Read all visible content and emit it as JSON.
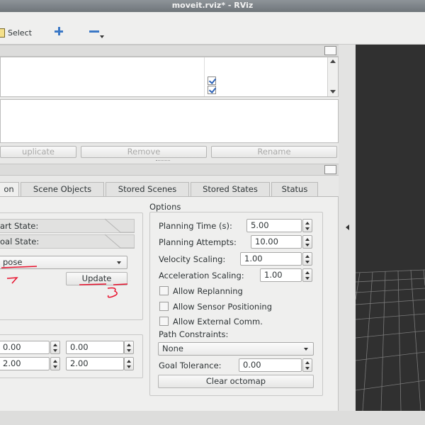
{
  "window": {
    "title": "moveit.rviz* - RViz"
  },
  "toolbar": {
    "select_label": "Select",
    "add_icon": "plus-icon",
    "remove_icon": "minus-icon"
  },
  "scene_list": {
    "checkboxes": [
      true,
      true
    ]
  },
  "list_buttons": {
    "duplicate": "uplicate",
    "remove": "Remove",
    "rename": "Rename"
  },
  "tabs": [
    {
      "label": "on",
      "active": true
    },
    {
      "label": "Scene Objects"
    },
    {
      "label": "Stored Scenes"
    },
    {
      "label": "Stored States"
    },
    {
      "label": "Status"
    }
  ],
  "planning": {
    "start_state_label": "art State:",
    "goal_state_label": "oal State:",
    "goal_combo_value": "pose",
    "update_button": "Update",
    "workspace_values": [
      [
        "0.00",
        "0.00"
      ],
      [
        "2.00",
        "2.00"
      ]
    ]
  },
  "options": {
    "title": "Options",
    "planning_time_label": "Planning Time (s):",
    "planning_time_value": "5.00",
    "planning_attempts_label": "Planning Attempts:",
    "planning_attempts_value": "10.00",
    "velocity_scaling_label": "Velocity Scaling:",
    "velocity_scaling_value": "1.00",
    "acceleration_scaling_label": "Acceleration Scaling:",
    "acceleration_scaling_value": "1.00",
    "allow_replanning": "Allow Replanning",
    "allow_sensor_positioning": "Allow Sensor Positioning",
    "allow_external_comm": "Allow External Comm.",
    "path_constraints_label": "Path Constraints:",
    "path_constraints_value": "None",
    "goal_tolerance_label": "Goal Tolerance:",
    "goal_tolerance_value": "0.00",
    "clear_octomap": "Clear octomap"
  },
  "annotations": {
    "mark_2": "2",
    "mark_3": "3"
  },
  "colors": {
    "annotation": "#e8112d",
    "viewport": "#303030",
    "accent": "#3b78c6"
  }
}
